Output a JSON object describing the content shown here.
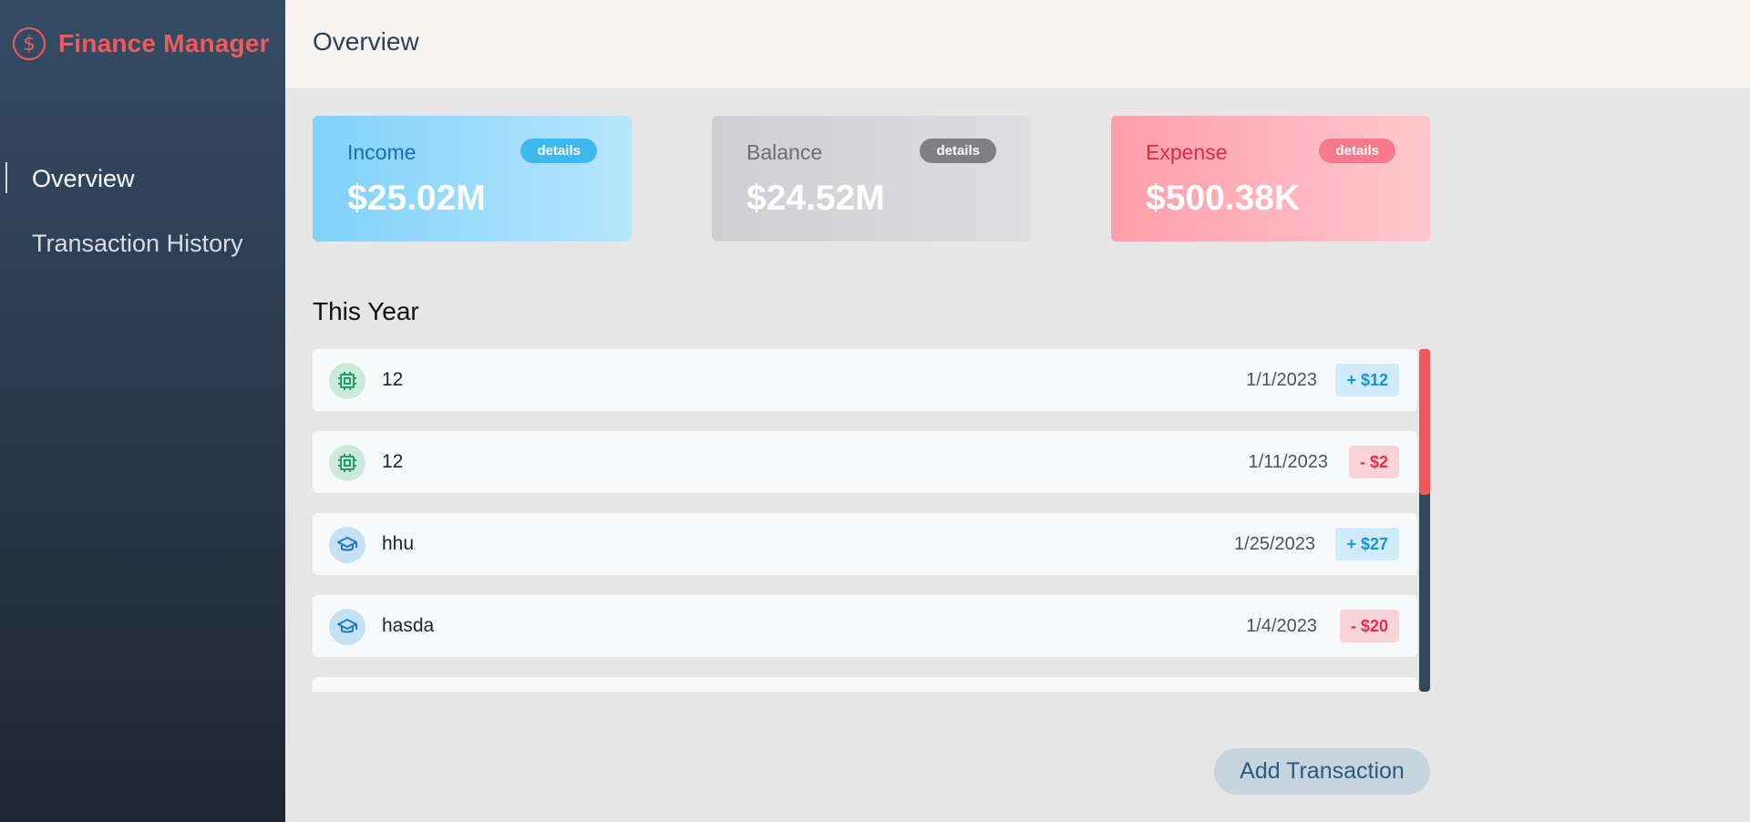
{
  "app": {
    "title": "Finance Manager",
    "brand_color": "#ef5a5a"
  },
  "sidebar": {
    "items": [
      {
        "label": "Overview",
        "active": true
      },
      {
        "label": "Transaction History",
        "active": false
      }
    ]
  },
  "header": {
    "title": "Overview"
  },
  "cards": {
    "income": {
      "label": "Income",
      "value": "$25.02M",
      "badge": "details"
    },
    "balance": {
      "label": "Balance",
      "value": "$24.52M",
      "badge": "details"
    },
    "expense": {
      "label": "Expense",
      "value": "$500.38K",
      "badge": "details"
    }
  },
  "section": {
    "title": "This Year"
  },
  "transactions": [
    {
      "name": "12",
      "date": "1/1/2023",
      "amount": "+ $12",
      "type": "income",
      "icon": "cpu-chip-icon"
    },
    {
      "name": "12",
      "date": "1/11/2023",
      "amount": "- $2",
      "type": "expense",
      "icon": "cpu-chip-icon"
    },
    {
      "name": "hhu",
      "date": "1/25/2023",
      "amount": "+ $27",
      "type": "income",
      "icon": "graduation-cap-icon"
    },
    {
      "name": "hasda",
      "date": "1/4/2023",
      "amount": "- $20",
      "type": "expense",
      "icon": "graduation-cap-icon"
    }
  ],
  "actions": {
    "add_transaction": "Add Transaction"
  }
}
